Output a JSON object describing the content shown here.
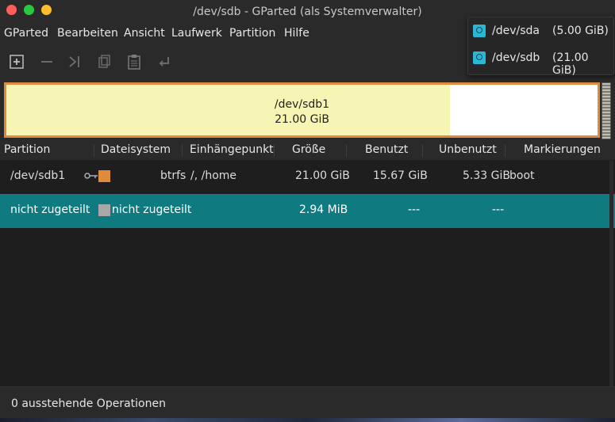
{
  "window": {
    "title": "/dev/sdb - GParted (als Systemverwalter)",
    "controls": [
      "close",
      "minimize",
      "maximize"
    ],
    "control_colors": {
      "close": "#ff5f57",
      "minimize": "#28c840",
      "maximize": "#febc2e"
    }
  },
  "menu": [
    "GParted",
    "Bearbeiten",
    "Ansicht",
    "Laufwerk",
    "Partition",
    "Hilfe"
  ],
  "toolbar": [
    "new-icon",
    "delete-icon",
    "resize-icon",
    "copy-icon",
    "paste-icon",
    "undo-icon"
  ],
  "disk_map": {
    "partition_name": "/dev/sdb1",
    "partition_size": "21.00 GiB",
    "used_fraction": 0.75,
    "colors": {
      "border": "#e08a3c",
      "used": "#f6f5b4",
      "free": "#ffffff"
    }
  },
  "table": {
    "headers": [
      "Partition",
      "Dateisystem",
      "Einhängepunkt",
      "Größe",
      "Benutzt",
      "Unbenutzt",
      "Markierungen"
    ],
    "rows": [
      {
        "partition": "/dev/sdb1",
        "filesystem": "btrfs",
        "mountpoint": "/, /home",
        "size": "21.00 GiB",
        "used": "15.67 GiB",
        "unused": "5.33 GiB",
        "flags": "boot",
        "fs_color": "#e08a3c",
        "selected": false
      },
      {
        "partition": "nicht zugeteilt",
        "filesystem": "nicht zugeteilt",
        "mountpoint": "",
        "size": "2.94 MiB",
        "used": "---",
        "unused": "---",
        "flags": "",
        "fs_color": "#a8a8a8",
        "selected": true
      }
    ],
    "selection_color": "#0f7b80"
  },
  "status": {
    "pending": "0 ausstehende Operationen"
  },
  "device_popup": [
    {
      "name": "/dev/sda",
      "size": "(5.00 GiB)"
    },
    {
      "name": "/dev/sdb",
      "size": "(21.00 GiB)"
    }
  ]
}
